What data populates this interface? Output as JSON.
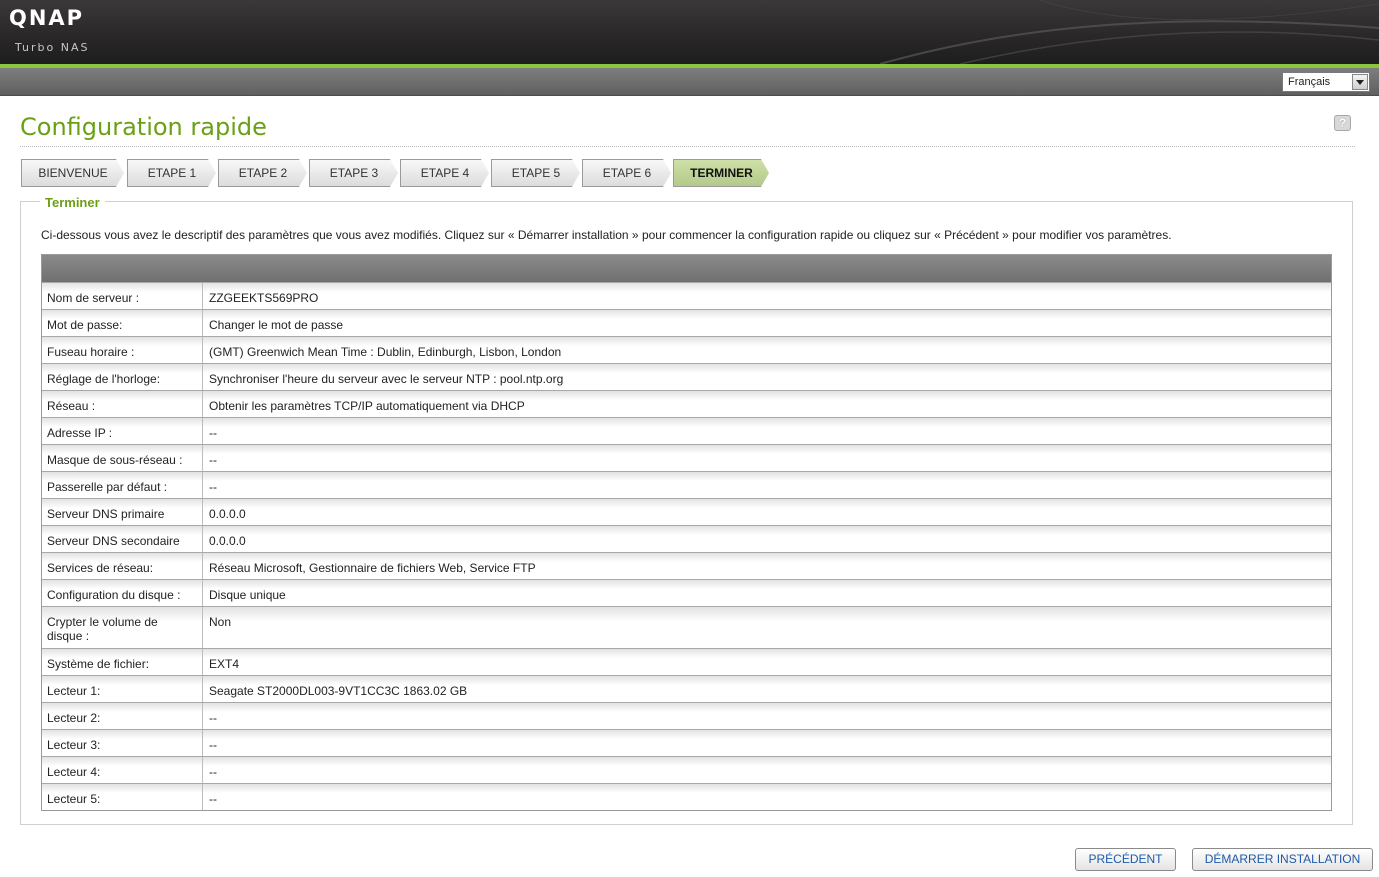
{
  "header": {
    "logo": "QNAP",
    "subtitle": "Turbo NAS",
    "language": "Français"
  },
  "colors": {
    "accent": "#6aa114",
    "header_green": "#8bc53f",
    "link": "#1f5aa8"
  },
  "page": {
    "title": "Configuration rapide",
    "help": "?"
  },
  "steps": [
    {
      "label": "BIENVENUE"
    },
    {
      "label": "ETAPE 1"
    },
    {
      "label": "ETAPE 2"
    },
    {
      "label": "ETAPE 3"
    },
    {
      "label": "ETAPE 4"
    },
    {
      "label": "ETAPE 5"
    },
    {
      "label": "ETAPE 6"
    },
    {
      "label": "TERMINER"
    }
  ],
  "panel": {
    "legend": "Terminer",
    "intro": "Ci-dessous vous avez le descriptif des paramètres que vous avez modifiés. Cliquez sur « Démarrer installation » pour commencer la configuration rapide ou cliquez sur « Précédent » pour modifier vos paramètres."
  },
  "summary": [
    {
      "label": "Nom de serveur :",
      "value": "ZZGEEKTS569PRO"
    },
    {
      "label": "Mot de passe:",
      "value": "Changer le mot de passe"
    },
    {
      "label": "Fuseau horaire :",
      "value": "(GMT) Greenwich Mean Time : Dublin, Edinburgh, Lisbon, London"
    },
    {
      "label": "Réglage de l'horloge:",
      "value": "Synchroniser l'heure du serveur avec le serveur NTP : pool.ntp.org"
    },
    {
      "label": "Réseau :",
      "value": "Obtenir les paramètres TCP/IP automatiquement via DHCP"
    },
    {
      "label": "Adresse IP :",
      "value": "--"
    },
    {
      "label": "Masque de sous-réseau :",
      "value": "--"
    },
    {
      "label": "Passerelle par défaut :",
      "value": "--"
    },
    {
      "label": "Serveur DNS primaire",
      "value": "0.0.0.0"
    },
    {
      "label": "Serveur DNS secondaire",
      "value": "0.0.0.0"
    },
    {
      "label": "Services de réseau:",
      "value": "Réseau Microsoft, Gestionnaire de fichiers Web, Service FTP"
    },
    {
      "label": "Configuration du disque :",
      "value": "Disque unique"
    },
    {
      "label": "Crypter le volume de disque :",
      "value": "Non"
    },
    {
      "label": "Système de fichier:",
      "value": "EXT4"
    },
    {
      "label": "Lecteur 1:",
      "value": "Seagate ST2000DL003-9VT1CC3C 1863.02 GB"
    },
    {
      "label": "Lecteur 2:",
      "value": "--"
    },
    {
      "label": "Lecteur 3:",
      "value": "--"
    },
    {
      "label": "Lecteur 4:",
      "value": "--"
    },
    {
      "label": "Lecteur 5:",
      "value": "--"
    }
  ],
  "buttons": {
    "previous": "PRÉCÉDENT",
    "start": "DÉMARRER INSTALLATION"
  }
}
